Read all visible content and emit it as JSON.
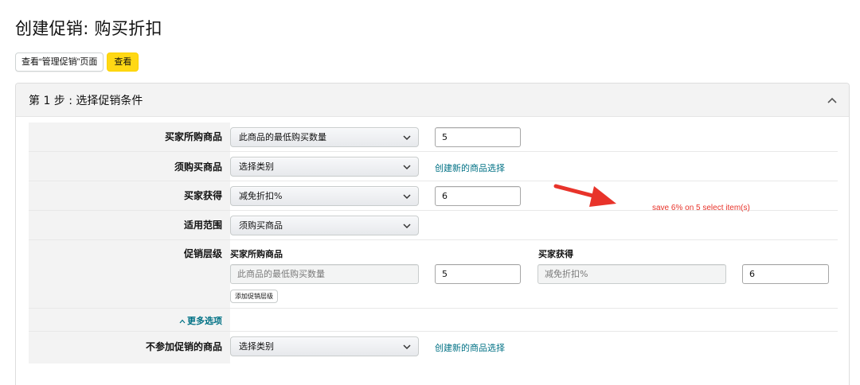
{
  "page": {
    "title": "创建促销: 购买折扣"
  },
  "top_actions": {
    "view_manage_label": "查看“管理促销”页面",
    "view_label": "查看"
  },
  "step1": {
    "title": "第 1 步 : 选择促销条件",
    "rows": {
      "buyer_purchase": {
        "label": "买家所购商品",
        "select_value": "此商品的最低购买数量",
        "input_value": "5"
      },
      "required_items": {
        "label": "须购买商品",
        "select_value": "选择类别",
        "link": "创建新的商品选择"
      },
      "buyer_gets": {
        "label": "买家获得",
        "select_value": "减免折扣%",
        "input_value": "6"
      },
      "applies_to": {
        "label": "适用范围",
        "select_value": "须购买商品"
      },
      "tiers": {
        "label": "促销层级",
        "col_buyer_purchase": "买家所购商品",
        "col_buyer_gets": "买家获得",
        "buyer_purchase_placeholder": "此商品的最低购买数量",
        "buyer_purchase_value": "5",
        "buyer_gets_placeholder": "减免折扣%",
        "buyer_gets_value": "6",
        "add_tier_label": "添加促销层级"
      },
      "more_options": {
        "label": "更多选项"
      },
      "excluded_items": {
        "label": "不参加促销的商品",
        "select_value": "选择类别",
        "link": "创建新的商品选择"
      }
    }
  },
  "annotation": {
    "text": "save 6% on 5 select item(s)",
    "color": "#e8332a"
  },
  "colors": {
    "link": "#007185",
    "primary_button": "#ffd814",
    "label_column_bg": "#f3f3f3"
  },
  "icons": {
    "collapse": "chevron-up-icon",
    "dropdown": "chevron-down-icon",
    "more_options": "caret-up-icon",
    "annotation": "red-arrow-icon"
  }
}
